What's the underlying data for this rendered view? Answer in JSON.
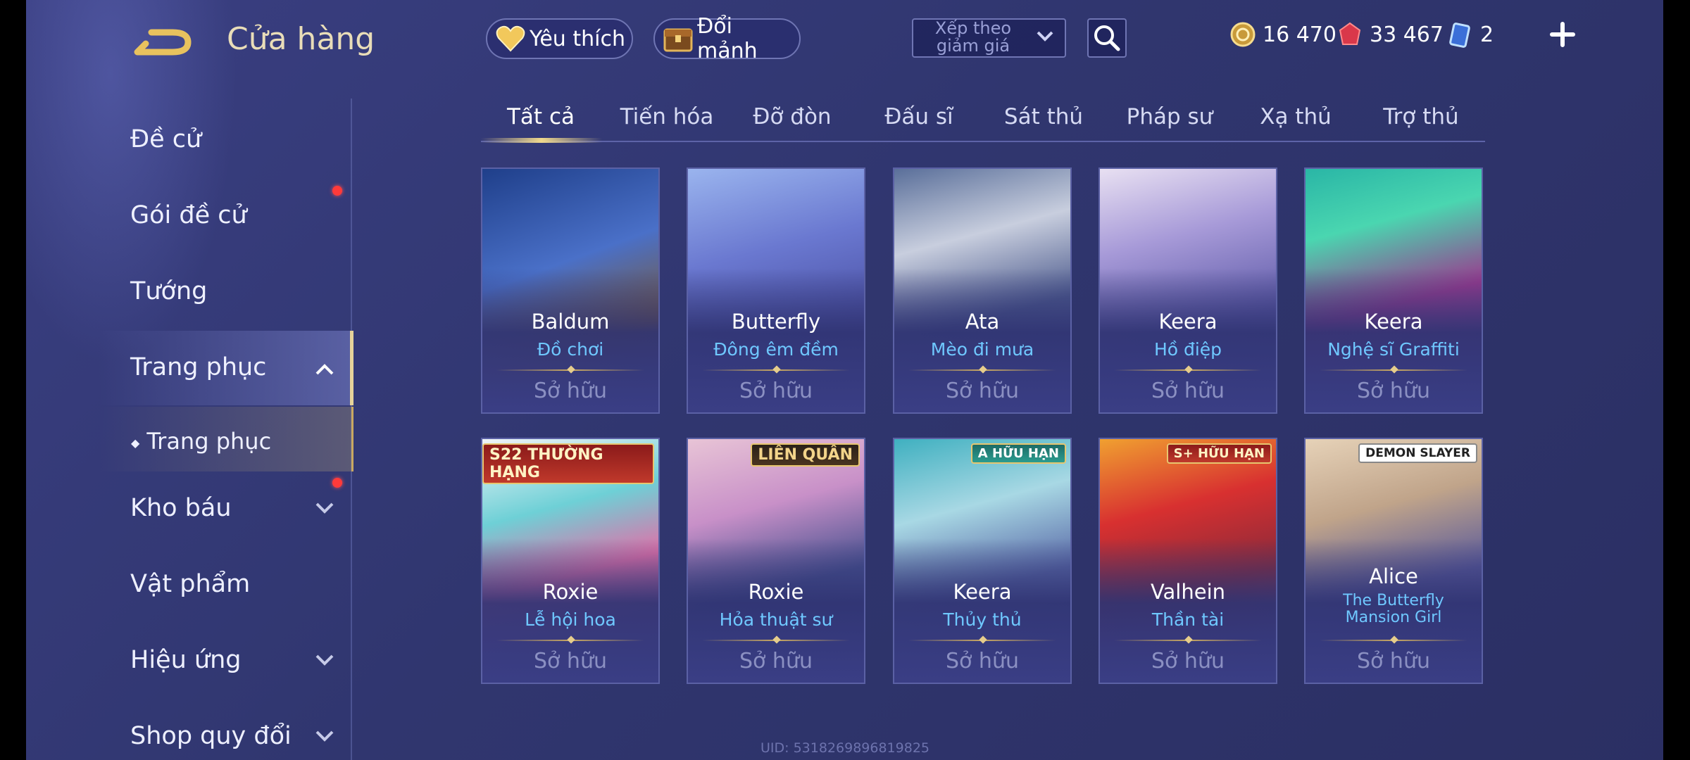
{
  "header": {
    "title": "Cửa hàng",
    "favorites_label": "Yêu thích",
    "exchange_label": "Đổi mảnh",
    "sort_label": "Xếp theo giảm giá",
    "currencies": [
      {
        "icon": "gold-coin-icon",
        "value": "16 470"
      },
      {
        "icon": "ruby-icon",
        "value": "33 467"
      },
      {
        "icon": "voucher-icon",
        "value": "2"
      }
    ]
  },
  "sidebar": {
    "items": [
      {
        "label": "Đề cử"
      },
      {
        "label": "Gói đề cử"
      },
      {
        "label": "Tướng"
      },
      {
        "label": "Trang phục"
      },
      {
        "label": "Trang phục"
      },
      {
        "label": "Kho báu"
      },
      {
        "label": "Vật phẩm"
      },
      {
        "label": "Hiệu ứng"
      },
      {
        "label": "Shop quy đổi"
      }
    ]
  },
  "tabs": [
    "Tất cả",
    "Tiến hóa",
    "Đỡ đòn",
    "Đấu sĩ",
    "Sát thủ",
    "Pháp sư",
    "Xạ thủ",
    "Trợ thủ"
  ],
  "cards": [
    {
      "hero": "Baldum",
      "skin": "Đồ chơi",
      "status": "Sở hữu"
    },
    {
      "hero": "Butterfly",
      "skin": "Đông êm đềm",
      "status": "Sở hữu"
    },
    {
      "hero": "Ata",
      "skin": "Mèo đi mưa",
      "status": "Sở hữu"
    },
    {
      "hero": "Keera",
      "skin": "Hồ điệp",
      "status": "Sở hữu"
    },
    {
      "hero": "Keera",
      "skin": "Nghệ sĩ Graffiti",
      "status": "Sở hữu"
    },
    {
      "hero": "Roxie",
      "skin": "Lễ hội hoa",
      "status": "Sở hữu",
      "badge": "S22 THƯỜNG HẠNG"
    },
    {
      "hero": "Roxie",
      "skin": "Hỏa thuật sư",
      "status": "Sở hữu",
      "badge": "LIÊN QUÂN"
    },
    {
      "hero": "Keera",
      "skin": "Thủy thủ",
      "status": "Sở hữu",
      "badge": "A HỮU HẠN"
    },
    {
      "hero": "Valhein",
      "skin": "Thần tài",
      "status": "Sở hữu",
      "badge": "S+ HỮU HẠN"
    },
    {
      "hero": "Alice",
      "skin": "The Butterfly Mansion Girl",
      "status": "Sở hữu",
      "badge": "DEMON SLAYER"
    }
  ],
  "footer": {
    "uid": "UID: 5318269896819825"
  },
  "colors": {
    "accent_gold": "#e6d39a",
    "skin_name_blue": "#6fc8ff",
    "notification_red": "#ff3a3a"
  }
}
